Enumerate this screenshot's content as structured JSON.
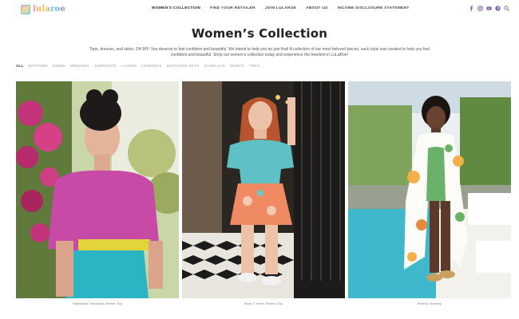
{
  "header": {
    "logo_text": "lularoe",
    "nav": [
      {
        "label": "WOMEN'S COLLECTION",
        "active": true
      },
      {
        "label": "FIND YOUR RETAILER",
        "active": false
      },
      {
        "label": "JOIN LULAROE",
        "active": false
      },
      {
        "label": "ABOUT US",
        "active": false
      },
      {
        "label": "INCOME DISCLOSURE STATEMENT",
        "active": false
      }
    ],
    "social_icons": [
      "facebook-icon",
      "instagram-icon",
      "youtube-icon",
      "pinterest-icon",
      "search-icon"
    ],
    "accent_color": "#7b5fa8"
  },
  "page": {
    "title": "Women’s Collection",
    "intro": "Tops, dresses, and skirts. OH MY! You deserve to feel confident and beautiful. We intend to help you do just that! A collection of our most beloved pieces, each style was created to help you feel confident and beautiful. Shop our women's collection today and experience the freedom in LuLaRoe!"
  },
  "filters": [
    "ALL",
    "BOTTOMS",
    "DENIM",
    "DRESSES",
    "JUMPSUITS",
    "LAYERS",
    "LEGGINGS",
    "MATCHING SETS",
    "OVERLAYS",
    "SKIRTS",
    "TOPS"
  ],
  "products": [
    {
      "name": "Stephanie Smocked Sleeve Top"
    },
    {
      "name": "Mary T Short Sleeve Top"
    },
    {
      "name": "Breezy Overlay"
    }
  ]
}
